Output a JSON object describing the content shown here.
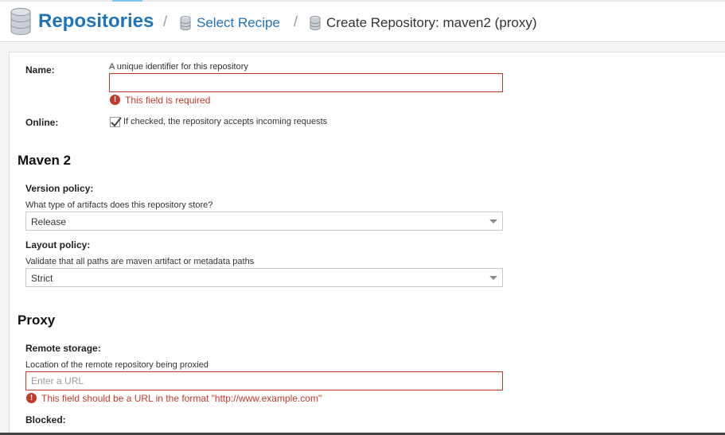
{
  "header": {
    "root_label": "Repositories",
    "separator": "/",
    "crumb_select_recipe": "Select Recipe",
    "crumb_current": "Create Repository: maven2 (proxy)"
  },
  "form": {
    "name": {
      "label": "Name:",
      "help": "A unique identifier for this repository",
      "value": "",
      "error": "This field is required"
    },
    "online": {
      "label": "Online:",
      "help": "If checked, the repository accepts incoming requests",
      "checked": true
    },
    "maven": {
      "section_title": "Maven 2",
      "version_policy": {
        "label": "Version policy:",
        "help": "What type of artifacts does this repository store?",
        "value": "Release"
      },
      "layout_policy": {
        "label": "Layout policy:",
        "help": "Validate that all paths are maven artifact or metadata paths",
        "value": "Strict"
      }
    },
    "proxy": {
      "section_title": "Proxy",
      "remote_storage": {
        "label": "Remote storage:",
        "help": "Location of the remote repository being proxied",
        "placeholder": "Enter a URL",
        "error": "This field should be a URL in the format \"http://www.example.com\""
      },
      "blocked": {
        "label": "Blocked:"
      }
    }
  },
  "icons": {
    "error_glyph": "!"
  },
  "colors": {
    "brand_blue": "#1f73b7",
    "error_red": "#c0392b"
  }
}
